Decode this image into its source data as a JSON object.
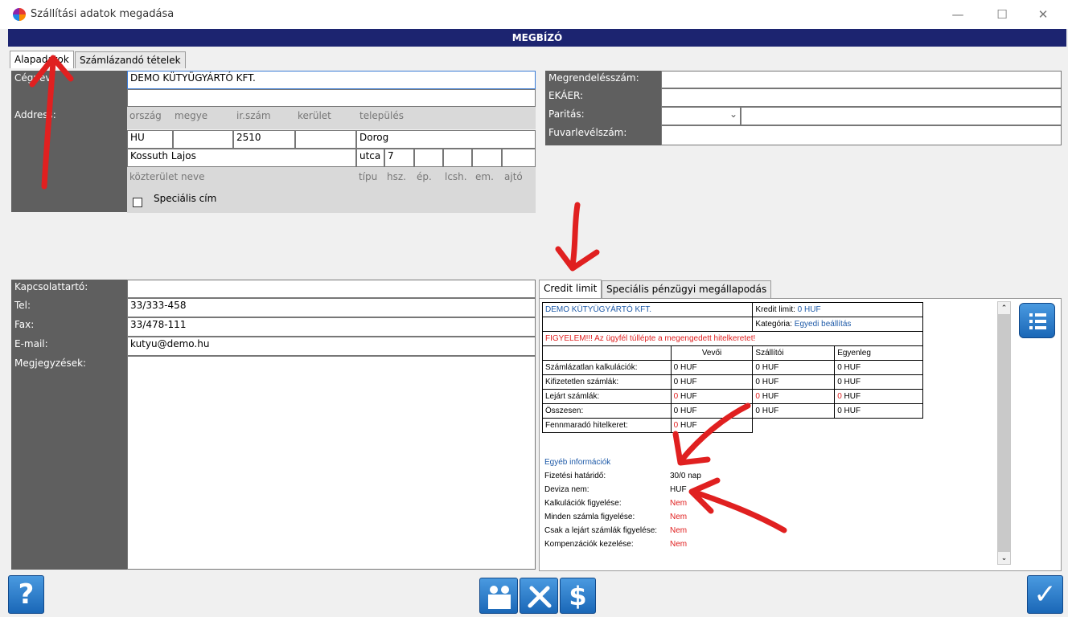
{
  "window": {
    "title": "Szállítási adatok megadása",
    "minimize": "—",
    "maximize": "☐",
    "close": "✕"
  },
  "header": {
    "title": "MEGBÍZÓ"
  },
  "tabs": [
    {
      "label": "Alapadatok"
    },
    {
      "label": "Számlázandó tételek"
    }
  ],
  "left": {
    "cegnev_label": "Cégnév:",
    "cegnev_value": "DEMO KÜTYÜGYÁRTÓ KFT.",
    "address_label": "Address:",
    "hints_top": [
      "ország",
      "megye",
      "ir.szám",
      "kerület",
      "település"
    ],
    "country": "HU",
    "county": "",
    "zip": "2510",
    "district": "",
    "city": "Dorog",
    "street": "Kossuth Lajos",
    "street_type": "utca",
    "house_no": "7",
    "hints_bottom": [
      "közterület neve",
      "típu",
      "hsz.",
      "ép.",
      "lcsh.",
      "em.",
      "ajtó"
    ],
    "special_address": "Speciális cím",
    "contact_label": "Kapcsolattartó:",
    "contact_value": "",
    "tel_label": "Tel:",
    "tel_value": "33/333-458",
    "fax_label": "Fax:",
    "fax_value": "33/478-111",
    "email_label": "E-mail:",
    "email_value": "kutyu@demo.hu",
    "notes_label": "Megjegyzések:"
  },
  "right": {
    "order_label": "Megrendelésszám:",
    "ekaer_label": "EKÁER:",
    "parity_label": "Paritás:",
    "waybill_label": "Fuvarlevélszám:"
  },
  "credit_tabs": [
    {
      "label": "Credit limit"
    },
    {
      "label": "Speciális pénzügyi megállapodás"
    }
  ],
  "credit": {
    "company": "DEMO KÜTYÜGYÁRTÓ KFT.",
    "kredit_limit_label": "Kredit limit:",
    "kredit_limit_value": "0 HUF",
    "category_label": "Kategória:",
    "category_value": "Egyedi beállítás",
    "warning": "FIGYELEM!!! Az ügyfél túllépte a megengedett hitelkeretet!",
    "col_headers": [
      "Vevői",
      "Szállítói",
      "Egyenleg"
    ],
    "rows": [
      {
        "label": "Számlázatlan kalkulációk:",
        "v1": "0 HUF",
        "v2": "0 HUF",
        "v3": "0 HUF"
      },
      {
        "label": "Kifizetetlen számlák:",
        "v1": "0 HUF",
        "v2": "0 HUF",
        "v3": "0 HUF"
      },
      {
        "label": "Lejárt számlák:",
        "v1": "0",
        "v2": "0",
        "v3": "0",
        "unit": "HUF"
      },
      {
        "label": "Összesen:",
        "v1": "0 HUF",
        "v2": "0 HUF",
        "v3": "0 HUF"
      }
    ],
    "remaining_label": "Fennmaradó hitelkeret:",
    "remaining_num": "0",
    "remaining_unit": "HUF",
    "other_info_title": "Egyéb információk",
    "info": [
      {
        "label": "Fizetési határidő:",
        "value": "30/0 nap"
      },
      {
        "label": "Deviza nem:",
        "value": "HUF"
      },
      {
        "label": "Kalkulációk figyelése:",
        "value": "Nem"
      },
      {
        "label": "Minden számla figyelése:",
        "value": "Nem"
      },
      {
        "label": "Csak a lejárt számlák figyelése:",
        "value": "Nem"
      },
      {
        "label": "Kompenzációk kezelése:",
        "value": "Nem"
      }
    ]
  },
  "footer": {
    "help": "?",
    "dollar": "$",
    "ok": "✓"
  },
  "colors": {
    "header": "#1c2470",
    "label_bg": "#5f5f5f",
    "annotation": "#e02020",
    "button": "#1a67b7"
  }
}
